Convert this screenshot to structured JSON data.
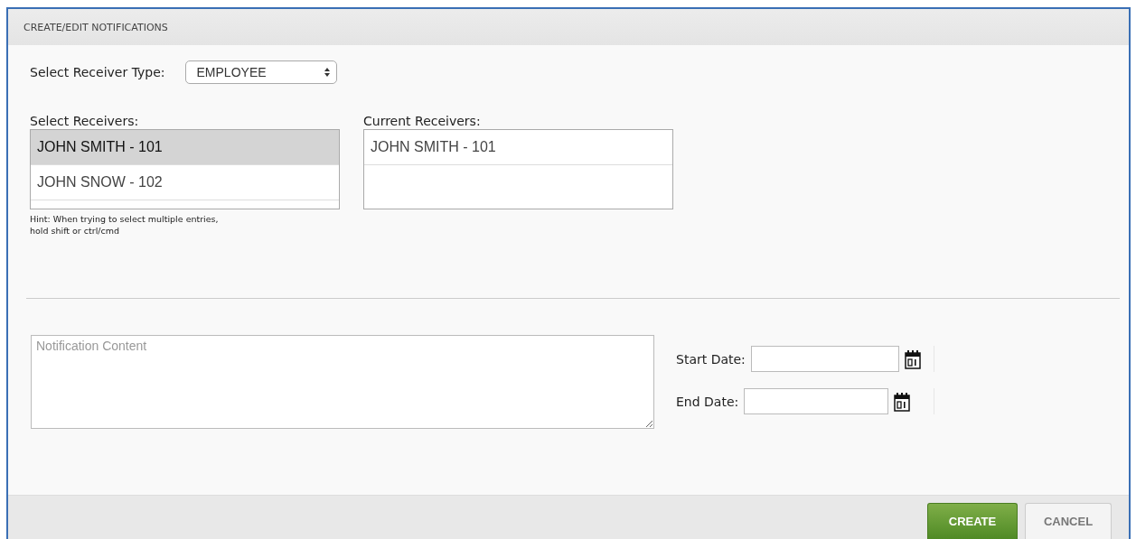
{
  "panel": {
    "title": "CREATE/EDIT NOTIFICATIONS"
  },
  "receiver_type": {
    "label": "Select Receiver Type:",
    "value": "EMPLOYEE"
  },
  "select_receivers": {
    "label": "Select Receivers:",
    "items": [
      {
        "label": "JOHN SMITH - 101",
        "selected": true
      },
      {
        "label": "JOHN SNOW - 102",
        "selected": false
      }
    ]
  },
  "hint": "Hint: When trying to select multiple entries, hold shift or ctrl/cmd",
  "current_receivers": {
    "label": "Current Receivers:",
    "items": [
      {
        "label": "JOHN SMITH - 101"
      }
    ]
  },
  "content": {
    "placeholder": "Notification Content"
  },
  "start_date": {
    "label": "Start Date:"
  },
  "end_date": {
    "label": "End Date:"
  },
  "buttons": [
    {
      "label": "CREATE",
      "kind": "primary"
    },
    {
      "label": "CANCEL",
      "kind": "secondary"
    }
  ]
}
